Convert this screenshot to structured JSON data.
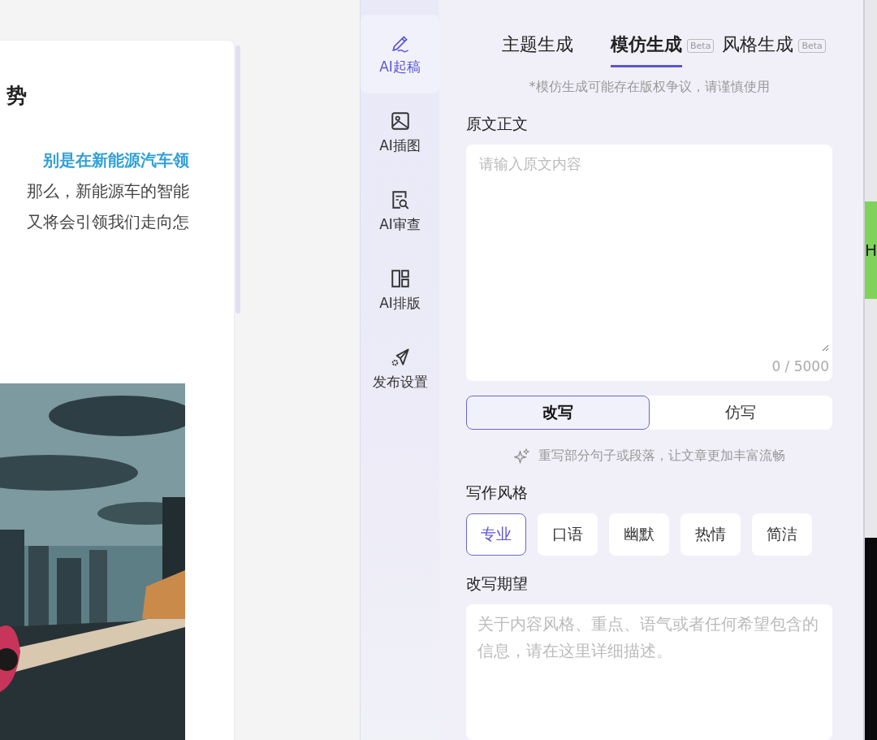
{
  "document": {
    "title": "势",
    "lines": [
      {
        "text": "别是在新能源汽车领",
        "highlight": true
      },
      {
        "text": "那么，新能源车的智能",
        "highlight": false
      },
      {
        "text": "又将会引领我们走向怎",
        "highlight": false
      }
    ]
  },
  "sidebar": {
    "items": [
      {
        "label": "AI起稿",
        "selected": true
      },
      {
        "label": "AI插图",
        "selected": false
      },
      {
        "label": "AI审查",
        "selected": false
      },
      {
        "label": "AI排版",
        "selected": false
      },
      {
        "label": "发布设置",
        "selected": false
      }
    ]
  },
  "tabs": [
    {
      "label": "主题生成",
      "selected": false
    },
    {
      "label": "模仿生成",
      "selected": true,
      "badge": "Beta"
    },
    {
      "label": "风格生成",
      "selected": false,
      "badge": "Beta"
    }
  ],
  "notice": "*模仿生成可能存在版权争议，请谨慎使用",
  "source": {
    "label": "原文正文",
    "placeholder": "请输入原文内容",
    "counter": "0 / 5000"
  },
  "modes": [
    {
      "label": "改写",
      "selected": true
    },
    {
      "label": "仿写",
      "selected": false
    }
  ],
  "mode_hint": "重写部分句子或段落，让文章更加丰富流畅",
  "style": {
    "label": "写作风格",
    "options": [
      {
        "label": "专业",
        "selected": true
      },
      {
        "label": "口语",
        "selected": false
      },
      {
        "label": "幽默",
        "selected": false
      },
      {
        "label": "热情",
        "selected": false
      },
      {
        "label": "简洁",
        "selected": false
      }
    ]
  },
  "expectation": {
    "label": "改写期望",
    "placeholder": "关于内容风格、重点、语气或者任何希望包含的信息，请在这里详细描述。"
  },
  "side_tab": {
    "label": "H"
  }
}
